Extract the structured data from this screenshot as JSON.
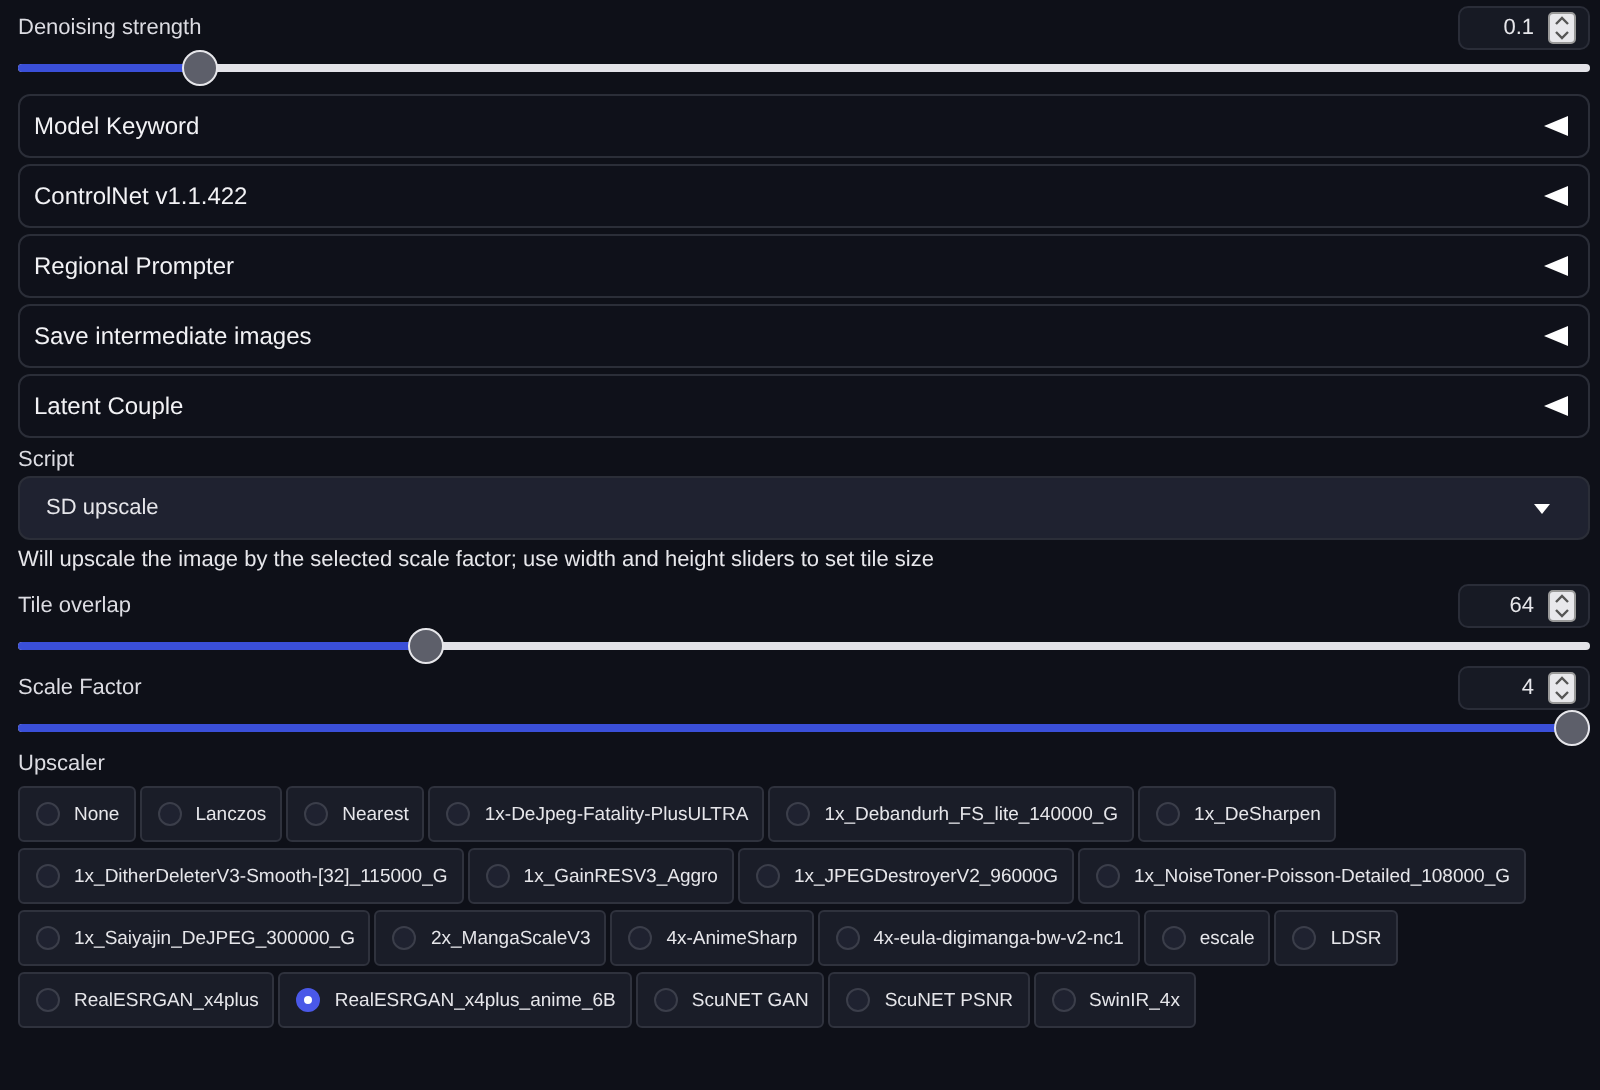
{
  "denoising": {
    "label": "Denoising strength",
    "value": "0.1",
    "level": 0.107
  },
  "accordions": [
    {
      "label": "Model Keyword",
      "expanded": false
    },
    {
      "label": "ControlNet v1.1.422",
      "expanded": false
    },
    {
      "label": "Regional Prompter",
      "expanded": false
    },
    {
      "label": "Save intermediate images",
      "expanded": false
    },
    {
      "label": "Latent Couple",
      "expanded": false
    }
  ],
  "script": {
    "label": "Script",
    "value": "SD upscale",
    "description": "Will upscale the image by the selected scale factor; use width and height sliders to set tile size"
  },
  "sliders": [
    {
      "label": "Tile overlap",
      "value": "64",
      "level": 0.254
    },
    {
      "label": "Scale Factor",
      "value": "4",
      "level": 1
    }
  ],
  "upscaler": {
    "label": "Upscaler",
    "options": [
      {
        "label": "None",
        "selected": false
      },
      {
        "label": "Lanczos",
        "selected": false
      },
      {
        "label": "Nearest",
        "selected": false
      },
      {
        "label": "1x-DeJpeg-Fatality-PlusULTRA",
        "selected": false
      },
      {
        "label": "1x_Debandurh_FS_lite_140000_G",
        "selected": false
      },
      {
        "label": "1x_DeSharpen",
        "selected": false
      },
      {
        "label": "1x_DitherDeleterV3-Smooth-[32]_115000_G",
        "selected": false
      },
      {
        "label": "1x_GainRESV3_Aggro",
        "selected": false
      },
      {
        "label": "1x_JPEGDestroyerV2_96000G",
        "selected": false
      },
      {
        "label": "1x_NoiseToner-Poisson-Detailed_108000_G",
        "selected": false
      },
      {
        "label": "1x_Saiyajin_DeJPEG_300000_G",
        "selected": false
      },
      {
        "label": "2x_MangaScaleV3",
        "selected": false
      },
      {
        "label": "4x-AnimeSharp",
        "selected": false
      },
      {
        "label": "4x-eula-digimanga-bw-v2-nc1",
        "selected": false
      },
      {
        "label": "escale",
        "selected": false
      },
      {
        "label": "LDSR",
        "selected": false
      },
      {
        "label": "RealESRGAN_x4plus",
        "selected": false
      },
      {
        "label": "RealESRGAN_x4plus_anime_6B",
        "selected": true
      },
      {
        "label": "ScuNET GAN",
        "selected": false
      },
      {
        "label": "ScuNET PSNR",
        "selected": false
      },
      {
        "label": "SwinIR_4x",
        "selected": false
      }
    ]
  }
}
